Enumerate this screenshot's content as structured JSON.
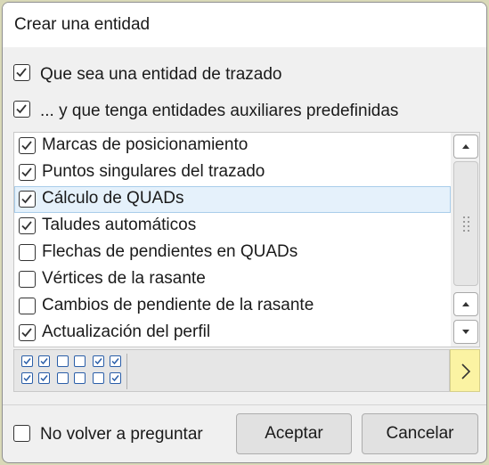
{
  "dialog": {
    "title": "Crear una entidad",
    "option_trazado": {
      "label": "Que sea una entidad de trazado",
      "checked": true
    },
    "option_auxiliares": {
      "label": "... y que tenga entidades auxiliares predefinidas",
      "checked": true
    },
    "list_items": [
      {
        "label": "Marcas de posicionamiento",
        "checked": true,
        "selected": false
      },
      {
        "label": "Puntos singulares del trazado",
        "checked": true,
        "selected": false
      },
      {
        "label": "Cálculo de QUADs",
        "checked": true,
        "selected": true
      },
      {
        "label": "Taludes automáticos",
        "checked": true,
        "selected": false
      },
      {
        "label": "Flechas de pendientes en QUADs",
        "checked": false,
        "selected": false
      },
      {
        "label": "Vértices de la rasante",
        "checked": false,
        "selected": false
      },
      {
        "label": "Cambios de pendiente de la rasante",
        "checked": false,
        "selected": false
      },
      {
        "label": "Actualización del perfil",
        "checked": true,
        "selected": false
      }
    ],
    "presets": [
      [
        "checked",
        "checked",
        "unchecked",
        "unchecked",
        "checked",
        "checked"
      ],
      [
        "checked",
        "checked",
        "unchecked",
        "unchecked",
        "unchecked",
        "checked"
      ]
    ],
    "no_ask_again": {
      "label": "No volver a preguntar",
      "checked": false
    },
    "accept_label": "Aceptar",
    "cancel_label": "Cancelar",
    "colors": {
      "accent": "#2a5ea8",
      "selected_row": "#e5f1fb",
      "next_button": "#fbf3a3"
    },
    "icons": {
      "scroll_up": "chevron-up-icon",
      "scroll_down": "chevron-down-icon",
      "next": "chevron-right-icon"
    }
  }
}
